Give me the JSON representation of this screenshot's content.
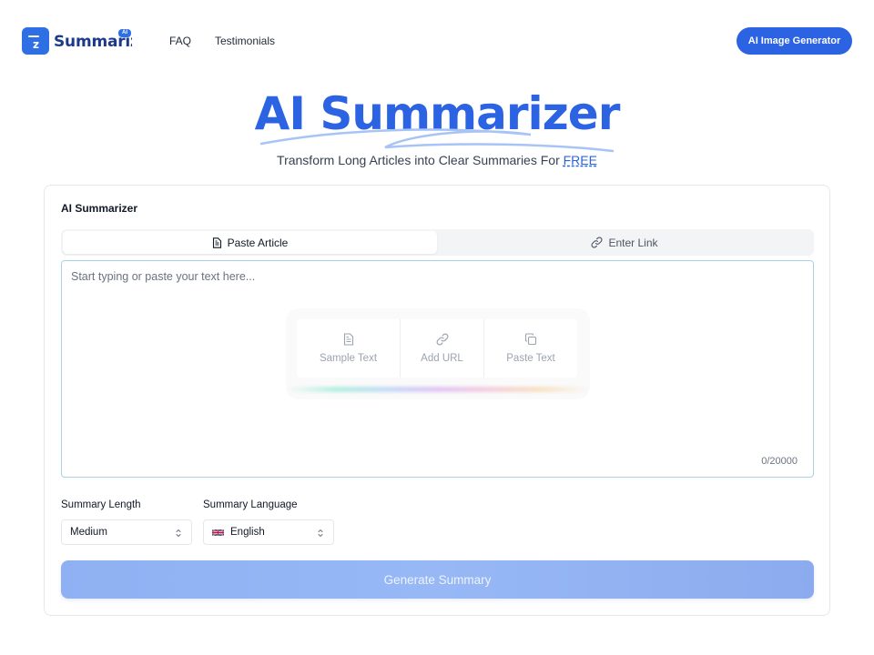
{
  "header": {
    "logo_text": "Summarizer",
    "logo_badge": "AI",
    "nav": [
      {
        "label": "FAQ"
      },
      {
        "label": "Testimonials"
      }
    ],
    "cta_label": "AI Image Generator"
  },
  "hero": {
    "title": "AI Summarizer",
    "subtitle_prefix": "Transform Long Articles into Clear Summaries For ",
    "subtitle_highlight": "FREE"
  },
  "card": {
    "title": "AI Summarizer",
    "tabs": [
      {
        "label": "Paste Article",
        "icon": "document-icon",
        "active": true
      },
      {
        "label": "Enter Link",
        "icon": "link-icon",
        "active": false
      }
    ],
    "input": {
      "placeholder": "Start typing or paste your text here...",
      "value": "",
      "counter": "0/20000"
    },
    "quick_actions": [
      {
        "label": "Sample Text",
        "icon": "document-icon"
      },
      {
        "label": "Add URL",
        "icon": "link-icon"
      },
      {
        "label": "Paste Text",
        "icon": "copy-icon"
      }
    ],
    "options": {
      "length_label": "Summary Length",
      "length_value": "Medium",
      "language_label": "Summary Language",
      "language_flag": "🇬🇧",
      "language_value": "English"
    },
    "generate_label": "Generate Summary"
  },
  "colors": {
    "brand": "#2b63e3",
    "button_disabled": "#94b4f4",
    "input_border": "#a9d2e6"
  }
}
